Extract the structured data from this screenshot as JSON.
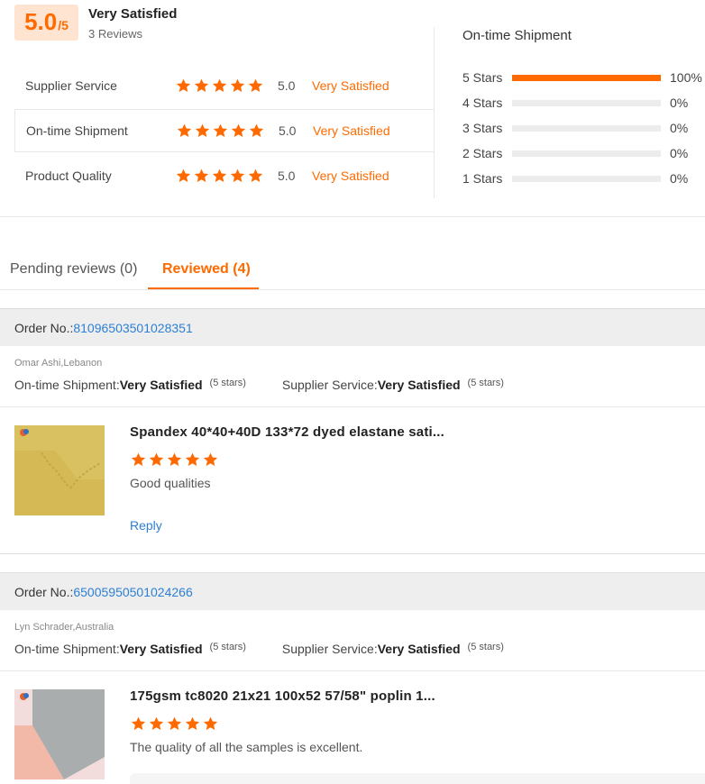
{
  "summary": {
    "score": "5.0",
    "score_max": "/5",
    "overall_label": "Very Satisfied",
    "review_count": "3 Reviews",
    "metrics": [
      {
        "name": "Supplier Service",
        "stars": 5,
        "value": "5.0",
        "label": "Very Satisfied"
      },
      {
        "name": "On-time Shipment",
        "stars": 5,
        "value": "5.0",
        "label": "Very Satisfied"
      },
      {
        "name": "Product Quality",
        "stars": 5,
        "value": "5.0",
        "label": "Very Satisfied"
      }
    ],
    "distribution_title": "On-time Shipment",
    "distribution": [
      {
        "label": "5  Stars",
        "percent": 100,
        "percent_text": "100%"
      },
      {
        "label": "4  Stars",
        "percent": 0,
        "percent_text": "0%"
      },
      {
        "label": "3  Stars",
        "percent": 0,
        "percent_text": "0%"
      },
      {
        "label": "2  Stars",
        "percent": 0,
        "percent_text": "0%"
      },
      {
        "label": "1  Stars",
        "percent": 0,
        "percent_text": "0%"
      }
    ]
  },
  "tabs": {
    "pending": "Pending reviews (0)",
    "reviewed": "Reviewed (4)"
  },
  "orders": [
    {
      "order_label": "Order No.: ",
      "order_no": "81096503501028351",
      "reviewer": "Omar Ashi,Lebanon",
      "shipment_label": "On-time Shipment: ",
      "shipment_value": "Very Satisfied",
      "shipment_stars": "(5 stars)",
      "service_label": "Supplier Service: ",
      "service_value": "Very Satisfied",
      "service_stars": "(5 stars)",
      "product_title": "Spandex 40*40+40D 133*72 dyed elastane sati...",
      "rating": 5,
      "review": "Good qualities",
      "reply": "Reply"
    },
    {
      "order_label": "Order No.: ",
      "order_no": "65005950501024266",
      "reviewer": "Lyn Schrader,Australia",
      "shipment_label": "On-time Shipment: ",
      "shipment_value": "Very Satisfied",
      "shipment_stars": "(5 stars)",
      "service_label": "Supplier Service: ",
      "service_value": "Very Satisfied",
      "service_stars": "(5 stars)",
      "product_title": "175gsm tc8020 21x21 100x52 57/58\" poplin 1...",
      "rating": 5,
      "review": "The quality of all the samples is excellent."
    }
  ],
  "colors": {
    "accent": "#ff6a00",
    "link": "#2c7fd5"
  }
}
